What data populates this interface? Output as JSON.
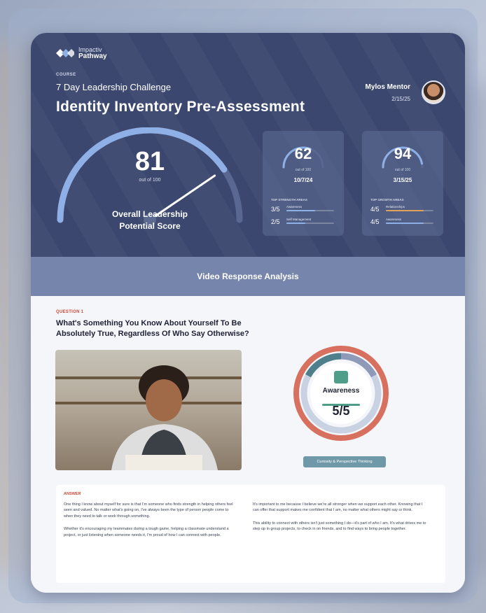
{
  "brand": {
    "line1": "Impactiv",
    "line2": "Pathway",
    "colors": {
      "navy": "#3d4971",
      "accent_blue": "#8fb0e6",
      "coral": "#d8705f",
      "teal": "#4e9e8a"
    }
  },
  "header": {
    "course_label": "COURSE",
    "course_name": "7 Day Leadership Challenge",
    "title": "Identity Inventory Pre-Assessment",
    "mentor_name": "Mylos Mentor",
    "mentor_date": "2/15/25"
  },
  "overall": {
    "score": "81",
    "out_of": "out of 100",
    "label_line1": "Overall Leadership",
    "label_line2": "Potential Score",
    "fraction": 0.81
  },
  "mini_cards": [
    {
      "score": "62",
      "out_of": "out of 100",
      "date": "10/7/24",
      "fraction": 0.62,
      "sub_label": "TOP STRENGTH AREAS",
      "rows": [
        {
          "num": "3/5",
          "name": "Awareness",
          "fraction": 0.6,
          "color": "#8fb0e6"
        },
        {
          "num": "2/5",
          "name": "Self Management",
          "fraction": 0.4,
          "color": "#8fb0e6"
        }
      ]
    },
    {
      "score": "94",
      "out_of": "out of 100",
      "date": "3/15/25",
      "fraction": 0.94,
      "sub_label": "TOP GROWTH AREAS",
      "rows": [
        {
          "num": "4/5",
          "name": "Relationships",
          "fraction": 0.8,
          "color": "#e0a25a"
        },
        {
          "num": "4/5",
          "name": "Awareness",
          "fraction": 0.8,
          "color": "#8fb0e6"
        }
      ]
    }
  ],
  "band": {
    "title": "Video Response Analysis"
  },
  "question": {
    "label": "QUESTION 1",
    "text": "What's Something You Know About Yourself To Be Absolutely True, Regardless Of Who Say Otherwise?"
  },
  "trait": {
    "name": "Awareness",
    "score": "5/5",
    "icon": "people-icon",
    "tag": "Curiosity & Perspective Thinking"
  },
  "answer": {
    "label": "ANSWER",
    "left_p1": "One thing I know about myself for sure is that I'm someone who finds strength in helping others feel seen and valued. No matter what's going on, I've always been the type of person people come to when they need to talk or work through something.",
    "left_p2": "Whether it's encouraging my teammates during a tough game, helping a classmate understand a project, or just listening when someone needs it, I'm proud of how I can connect with people.",
    "right_p1": "It's important to me because I believe we're all stronger when we support each other. Knowing that I can offer that support makes me confident that I am, no matter what others might say or think.",
    "right_p2": "This ability to connect with others isn't just something I do—it's part of who I am. It's what drives me to step up in group projects, to check in on friends, and to find ways to bring people together."
  }
}
